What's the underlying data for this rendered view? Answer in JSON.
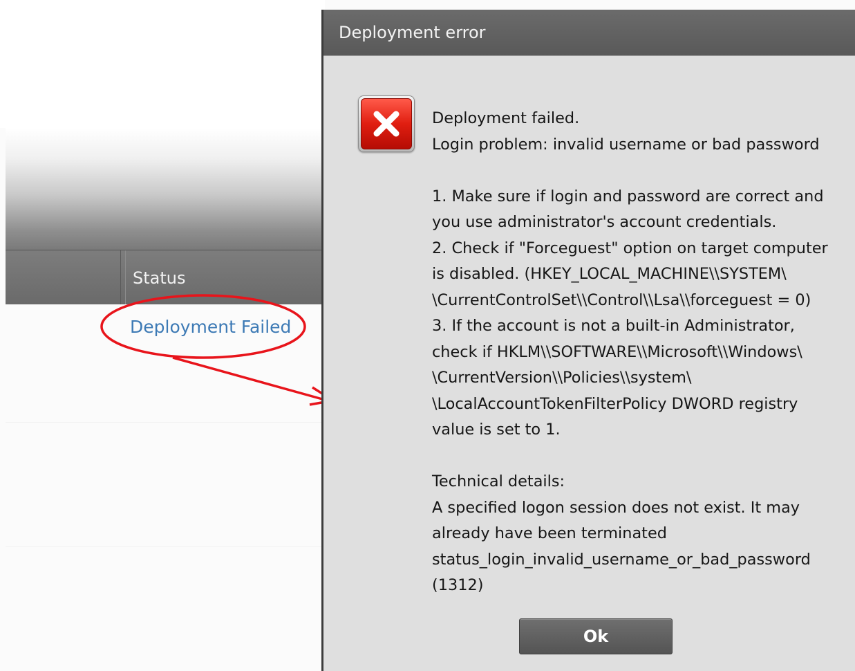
{
  "background_app": {
    "table_header": {
      "status_column": "Status"
    },
    "row": {
      "status_link": "Deployment Failed"
    }
  },
  "dialog": {
    "title": "Deployment error",
    "icon": "error-x-icon",
    "message_lines": [
      "Deployment failed.",
      "Login problem: invalid username or bad password",
      "",
      "1. Make sure if login and password are correct and",
      "you use administrator's account credentials.",
      "2. Check if \"Forceguest\" option on target computer",
      "is disabled.    (HKEY_LOCAL_MACHINE\\\\SYSTEM\\",
      "\\CurrentControlSet\\\\Control\\\\Lsa\\\\forceguest = 0)",
      "3. If the account is not a built-in Administrator,",
      "check if HKLM\\\\SOFTWARE\\\\Microsoft\\\\Windows\\",
      "\\CurrentVersion\\\\Policies\\\\system\\",
      "\\LocalAccountTokenFilterPolicy DWORD registry",
      "value is set to 1.",
      "",
      "Technical details:",
      "A specified logon session does not exist. It may",
      "already have been terminated",
      "status_login_invalid_username_or_bad_password",
      "(1312)"
    ],
    "ok_button": "Ok"
  },
  "colors": {
    "link": "#3d7ab5",
    "annotation_red": "#e8141b",
    "error_red": "#e01e10",
    "title_bar": "#5f5f5f"
  }
}
